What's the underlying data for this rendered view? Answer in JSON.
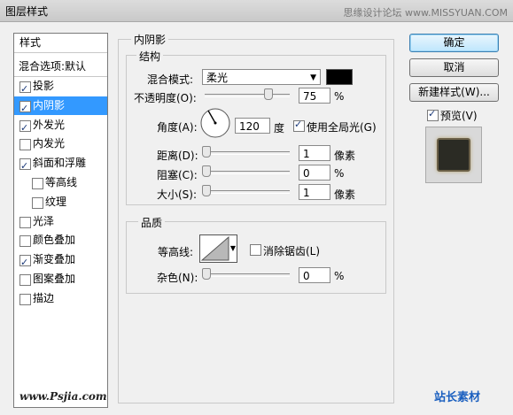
{
  "window": {
    "title": "图层样式",
    "watermark": "思缘设计论坛 www.MISSYUAN.COM"
  },
  "left_panel": {
    "header": "样式",
    "blend_options": "混合选项:默认",
    "items": [
      {
        "label": "投影",
        "checked": true
      },
      {
        "label": "内阴影",
        "checked": true,
        "selected": true
      },
      {
        "label": "外发光",
        "checked": true
      },
      {
        "label": "内发光",
        "checked": false
      },
      {
        "label": "斜面和浮雕",
        "checked": true
      },
      {
        "label": "等高线",
        "checked": false,
        "sub": true
      },
      {
        "label": "纹理",
        "checked": false,
        "sub": true
      },
      {
        "label": "光泽",
        "checked": false
      },
      {
        "label": "颜色叠加",
        "checked": false
      },
      {
        "label": "渐变叠加",
        "checked": true
      },
      {
        "label": "图案叠加",
        "checked": false
      },
      {
        "label": "描边",
        "checked": false
      }
    ]
  },
  "inner_shadow": {
    "title": "内阴影",
    "structure": {
      "title": "结构",
      "blend_mode_label": "混合模式:",
      "blend_mode_value": "柔光",
      "color": "#000000",
      "opacity_label": "不透明度(O):",
      "opacity_value": "75",
      "opacity_unit": "%",
      "angle_label": "角度(A):",
      "angle_value": "120",
      "angle_unit": "度",
      "global_light_label": "使用全局光(G)",
      "global_light_checked": true,
      "distance_label": "距离(D):",
      "distance_value": "1",
      "distance_unit": "像素",
      "choke_label": "阻塞(C):",
      "choke_value": "0",
      "choke_unit": "%",
      "size_label": "大小(S):",
      "size_value": "1",
      "size_unit": "像素"
    },
    "quality": {
      "title": "品质",
      "contour_label": "等高线:",
      "antialias_label": "消除锯齿(L)",
      "antialias_checked": false,
      "noise_label": "杂色(N):",
      "noise_value": "0",
      "noise_unit": "%"
    }
  },
  "buttons": {
    "ok": "确定",
    "cancel": "取消",
    "new_style": "新建样式(W)..."
  },
  "preview": {
    "label": "预览(V)",
    "checked": true
  },
  "footer": {
    "left_watermark": "www.Psjia.com",
    "right_logo": "站长素材"
  }
}
